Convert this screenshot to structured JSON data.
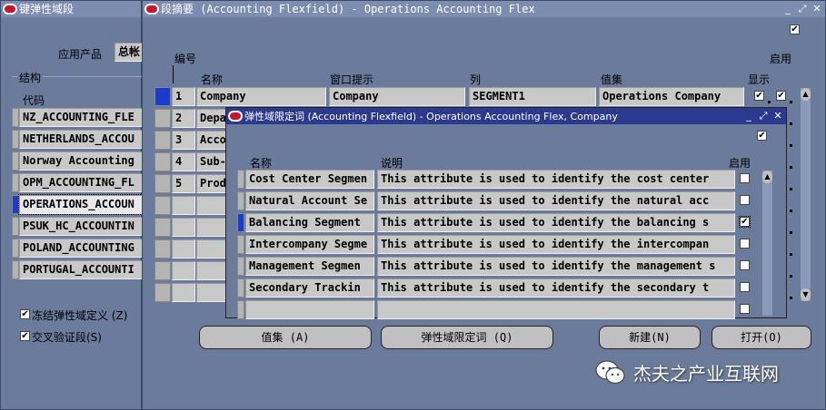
{
  "left_window": {
    "title": "键弹性域段",
    "app_label": "应用产品",
    "app_value": "总帐",
    "struct_label": "结构",
    "code_label": "代码",
    "rows": [
      "NZ_ACCOUNTING_FLE",
      "NETHERLANDS_ACCOU",
      "Norway Accounting",
      "OPM_ACCOUNTING_FL",
      "OPERATIONS_ACCOUN",
      "PSUK_HC_ACCOUNTIN",
      "POLAND_ACCOUNTING",
      "PORTUGAL_ACCOUNTI"
    ],
    "freeze_label": "冻结弹性域定义 (Z)",
    "cross_label": "交叉验证段(S)"
  },
  "segments_window": {
    "title": "段摘要 (Accounting Flexfield) - Operations Accounting Flex",
    "headers": {
      "num": "编号",
      "name": "名称",
      "window_prompt": "窗口提示",
      "column": "列",
      "value_set": "值集",
      "display": "显示",
      "enabled": "启用"
    },
    "rows": [
      {
        "num": "1",
        "name": "Company",
        "prompt": "Company",
        "column": "SEGMENT1",
        "value_set": "Operations Company"
      },
      {
        "num": "2",
        "name": "Depa"
      },
      {
        "num": "3",
        "name": "Acco"
      },
      {
        "num": "4",
        "name": "Sub-"
      },
      {
        "num": "5",
        "name": "Prod"
      }
    ],
    "buttons": {
      "value_set": "值集 (A)",
      "qualifiers": "弹性域限定词 (Q)",
      "new": "新建(N)",
      "open": "打开(O)"
    }
  },
  "qualifier_window": {
    "title": "弹性域限定词 (Accounting Flexfield) - Operations Accounting Flex, Company",
    "headers": {
      "name": "名称",
      "desc": "说明",
      "enabled": "启用"
    },
    "rows": [
      {
        "name": "Cost Center Segmen",
        "desc": "This attribute is used to identify the cost center"
      },
      {
        "name": "Natural Account Se",
        "desc": "This attribute is used to identify the natural acc"
      },
      {
        "name": "Balancing Segment",
        "desc": "This attribute is used to identify the balancing s"
      },
      {
        "name": "Intercompany Segme",
        "desc": "This attribute is used to identify the intercompan"
      },
      {
        "name": "Management Segmen",
        "desc": "This attribute is used to identify the management s"
      },
      {
        "name": "Secondary Trackin",
        "desc": "This attribute is used to identify the secondary t"
      }
    ]
  },
  "watermark": "杰夫之产业互联网"
}
